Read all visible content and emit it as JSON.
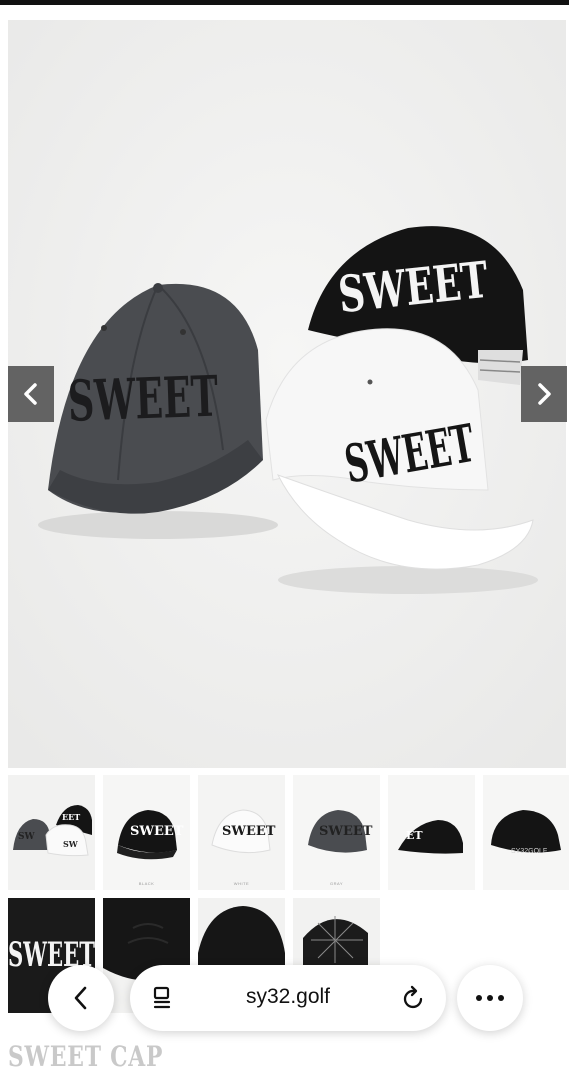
{
  "gallery": {
    "cap_text": "SWEET",
    "prev_label": "Previous image",
    "next_label": "Next image"
  },
  "thumbnails": [
    {
      "id": "t1",
      "text": ""
    },
    {
      "id": "t2",
      "text": "BLACK"
    },
    {
      "id": "t3",
      "text": "WHITE"
    },
    {
      "id": "t4",
      "text": "GRAY"
    },
    {
      "id": "t5",
      "text": ""
    },
    {
      "id": "t6",
      "text": ""
    },
    {
      "id": "t7",
      "text": ""
    },
    {
      "id": "t8",
      "text": ""
    },
    {
      "id": "t9",
      "text": ""
    },
    {
      "id": "t10",
      "text": ""
    }
  ],
  "caption": "SWEET CAP",
  "browser": {
    "url": "sy32.golf",
    "back_icon": "chevron-left-icon",
    "tabs_icon": "tabs-icon",
    "reload_icon": "reload-icon",
    "more_icon": "more-horizontal-icon"
  },
  "colors": {
    "gray_cap": "#4a4c50",
    "black_cap": "#141414",
    "white_cap": "#f7f7f7",
    "arrow_bg": "#3c3c3c"
  }
}
